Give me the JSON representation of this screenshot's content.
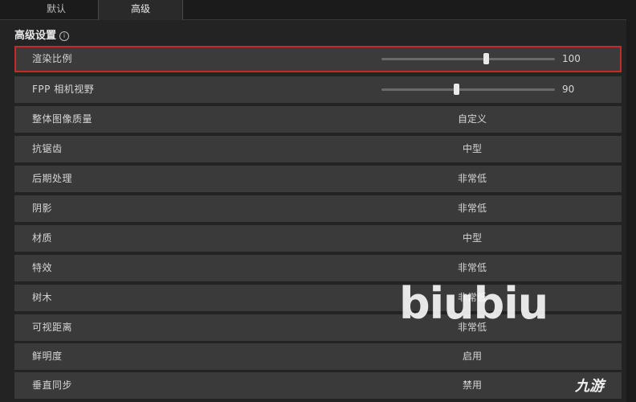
{
  "tabs": [
    "默认",
    "高级"
  ],
  "section": {
    "title": "高级设置",
    "info_icon": "info-icon"
  },
  "settings": [
    {
      "label": "渲染比例",
      "type": "slider",
      "value": 100,
      "fill": 0.6
    },
    {
      "label": "FPP 相机视野",
      "type": "slider",
      "value": 90,
      "fill": 0.43
    },
    {
      "label": "整体图像质量",
      "type": "select",
      "value": "自定义"
    },
    {
      "label": "抗锯齿",
      "type": "select",
      "value": "中型"
    },
    {
      "label": "后期处理",
      "type": "select",
      "value": "非常低"
    },
    {
      "label": "阴影",
      "type": "select",
      "value": "非常低"
    },
    {
      "label": "材质",
      "type": "select",
      "value": "中型"
    },
    {
      "label": "特效",
      "type": "select",
      "value": "非常低"
    },
    {
      "label": "树木",
      "type": "select",
      "value": "非常低"
    },
    {
      "label": "可视距离",
      "type": "select",
      "value": "非常低"
    },
    {
      "label": "鲜明度",
      "type": "select",
      "value": "启用"
    },
    {
      "label": "垂直同步",
      "type": "select",
      "value": "禁用"
    }
  ],
  "watermark": "biubiu",
  "logo": "九游",
  "colors": {
    "highlight_border": "#c42a2a",
    "row_bg": "#3a3a3a",
    "page_bg": "#232323"
  }
}
